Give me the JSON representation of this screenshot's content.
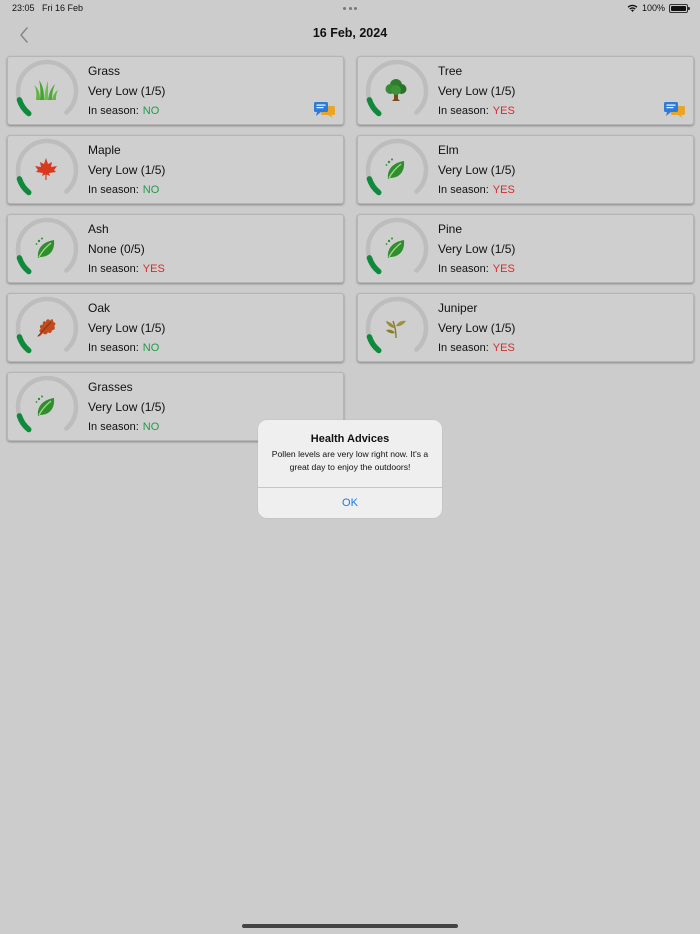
{
  "status_bar": {
    "time": "23:05",
    "date": "Fri 16 Feb",
    "battery": "100%"
  },
  "nav": {
    "title": "16 Feb, 2024"
  },
  "season_label": "In season:",
  "cards": [
    {
      "name": "Grass",
      "level": "Very Low (1/5)",
      "in_season": "NO",
      "icon": "grass-icon",
      "gauge_fill": 0.2,
      "has_chat": true
    },
    {
      "name": "Tree",
      "level": "Very Low (1/5)",
      "in_season": "YES",
      "icon": "tree-icon",
      "gauge_fill": 0.2,
      "has_chat": true
    },
    {
      "name": "Maple",
      "level": "Very Low (1/5)",
      "in_season": "NO",
      "icon": "maple-leaf-icon",
      "gauge_fill": 0.2,
      "has_chat": false
    },
    {
      "name": "Elm",
      "level": "Very Low (1/5)",
      "in_season": "YES",
      "icon": "leaf-icon",
      "gauge_fill": 0.2,
      "has_chat": false
    },
    {
      "name": "Ash",
      "level": "None (0/5)",
      "in_season": "YES",
      "icon": "leaf-icon",
      "gauge_fill": 0.2,
      "has_chat": false
    },
    {
      "name": "Pine",
      "level": "Very Low (1/5)",
      "in_season": "YES",
      "icon": "leaf-icon",
      "gauge_fill": 0.2,
      "has_chat": false
    },
    {
      "name": "Oak",
      "level": "Very Low (1/5)",
      "in_season": "NO",
      "icon": "oak-leaf-icon",
      "gauge_fill": 0.2,
      "has_chat": false
    },
    {
      "name": "Juniper",
      "level": "Very Low (1/5)",
      "in_season": "YES",
      "icon": "juniper-icon",
      "gauge_fill": 0.2,
      "has_chat": false
    },
    {
      "name": "Grasses",
      "level": "Very Low (1/5)",
      "in_season": "NO",
      "icon": "leaf-icon",
      "gauge_fill": 0.2,
      "has_chat": false
    }
  ],
  "alert": {
    "title": "Health Advices",
    "message": "Pollen levels are very low right now. It's a great day to enjoy the outdoors!",
    "ok_label": "OK"
  },
  "colors": {
    "gauge_fill": "#0f8a3c",
    "gauge_track": "#bdbdbd",
    "season_no": "#1e9c47",
    "season_yes": "#d42c2c",
    "accent": "#1a7ae0"
  }
}
